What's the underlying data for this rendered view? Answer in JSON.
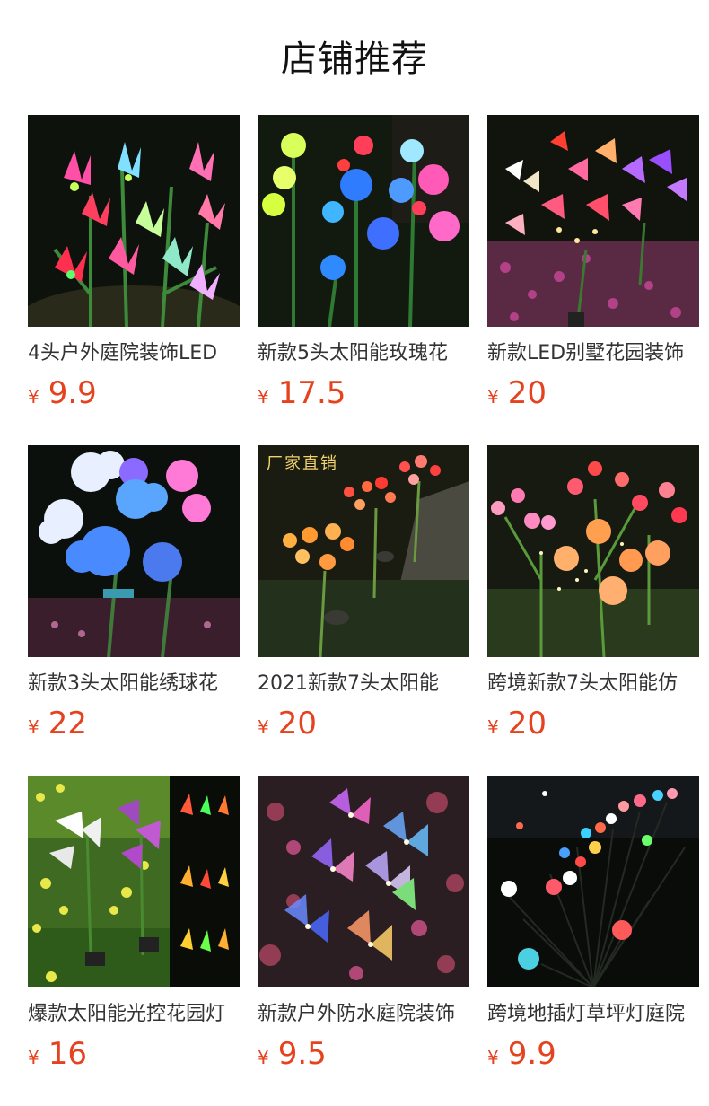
{
  "page": {
    "title": "店铺推荐"
  },
  "products": [
    {
      "name": "4头户外庭院装饰LED",
      "currency": "¥",
      "price": "9.9",
      "image_icon": "lily-lights-image"
    },
    {
      "name": "新款5头太阳能玫瑰花",
      "currency": "¥",
      "price": "17.5",
      "image_icon": "rose-lights-image"
    },
    {
      "name": "新款LED别墅花园装饰",
      "currency": "¥",
      "price": "20",
      "image_icon": "orchid-lights-image"
    },
    {
      "name": "新款3头太阳能绣球花",
      "currency": "¥",
      "price": "22",
      "image_icon": "hydrangea-lights-image"
    },
    {
      "name": "2021新款7头太阳能",
      "currency": "¥",
      "price": "20",
      "image_icon": "carnation-lights-image",
      "overlay_text": "厂家直销"
    },
    {
      "name": "跨境新款7头太阳能仿",
      "currency": "¥",
      "price": "20",
      "image_icon": "flower-bouquet-lights-image"
    },
    {
      "name": "爆款太阳能光控花园灯",
      "currency": "¥",
      "price": "16",
      "image_icon": "calla-lily-lights-image"
    },
    {
      "name": "新款户外防水庭院装饰",
      "currency": "¥",
      "price": "9.5",
      "image_icon": "butterfly-lights-image"
    },
    {
      "name": "跨境地插灯草坪灯庭院",
      "currency": "¥",
      "price": "9.9",
      "image_icon": "firefly-lights-image"
    }
  ],
  "colors": {
    "price": "#e5431f",
    "title": "#111111",
    "name": "#333333"
  }
}
